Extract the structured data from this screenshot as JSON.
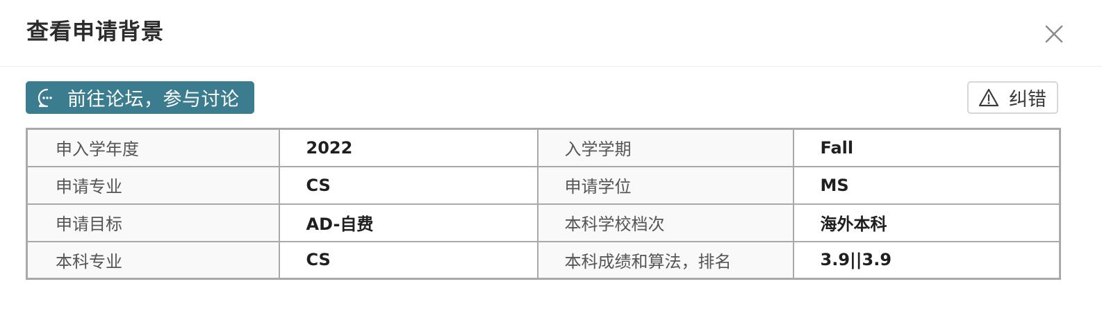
{
  "dialog": {
    "title": "查看申请背景"
  },
  "toolbar": {
    "forum_label": "前往论坛，参与讨论",
    "forum_icon": "chat-bubble-icon",
    "report_label": "纠错",
    "report_icon": "warning-triangle-icon",
    "accent_color": "#3b7c8f"
  },
  "table": {
    "rows": [
      [
        {
          "key": "申入学年度",
          "value": "2022"
        },
        {
          "key": "入学学期",
          "value": "Fall"
        }
      ],
      [
        {
          "key": "申请专业",
          "value": "CS"
        },
        {
          "key": "申请学位",
          "value": "MS"
        }
      ],
      [
        {
          "key": "申请目标",
          "value": "AD-自费"
        },
        {
          "key": "本科学校档次",
          "value": "海外本科"
        }
      ],
      [
        {
          "key": "本科专业",
          "value": "CS"
        },
        {
          "key": "本科成绩和算法，排名",
          "value": "3.9||3.9"
        }
      ]
    ]
  }
}
